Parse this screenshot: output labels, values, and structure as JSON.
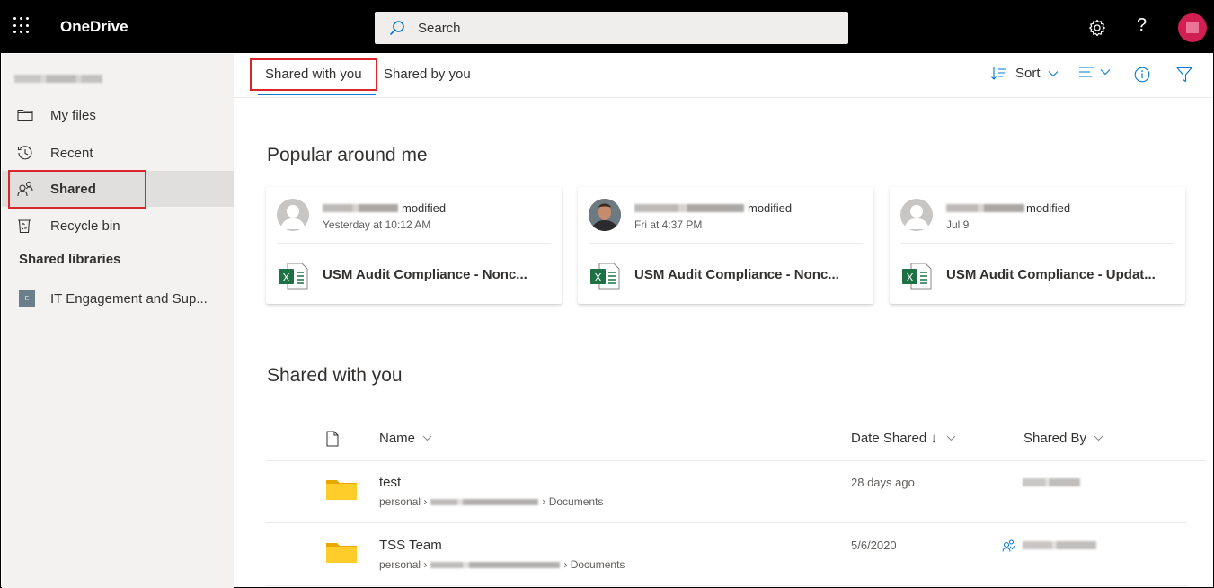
{
  "topbar": {
    "app_name": "OneDrive",
    "search_placeholder": "Search",
    "help_label": "?"
  },
  "sidebar": {
    "items": [
      {
        "label": "My files",
        "icon": "folder-icon"
      },
      {
        "label": "Recent",
        "icon": "clock-icon"
      },
      {
        "label": "Shared",
        "icon": "people-icon",
        "active": true
      },
      {
        "label": "Recycle bin",
        "icon": "recycle-bin-icon"
      }
    ],
    "shared_libraries_heading": "Shared libraries",
    "libraries": [
      {
        "label": "IT Engagement and Sup...",
        "icon_text": "E"
      }
    ]
  },
  "tabs": [
    {
      "label": "Shared with you",
      "selected": true
    },
    {
      "label": "Shared by you",
      "selected": false
    }
  ],
  "commands": {
    "sort_label": "Sort"
  },
  "popular": {
    "title": "Popular around me",
    "cards": [
      {
        "action": "modified",
        "when": "Yesterday at 10:12 AM",
        "file": "USM Audit Compliance - Nonc..."
      },
      {
        "action": "modified",
        "when": "Fri at 4:37 PM",
        "file": "USM Audit Compliance - Nonc..."
      },
      {
        "action": "modified",
        "when": "Jul 9",
        "file": "USM Audit Compliance - Updat..."
      }
    ]
  },
  "shared_with_you": {
    "title": "Shared with you",
    "columns": {
      "name": "Name",
      "date_shared": "Date Shared ↓",
      "shared_by": "Shared By"
    },
    "rows": [
      {
        "name": "test",
        "path_start": "personal ›",
        "path_end": "› Documents",
        "date": "28 days ago"
      },
      {
        "name": "TSS Team",
        "path_start": "personal ›",
        "path_end": "› Documents",
        "date": "5/6/2020"
      }
    ]
  },
  "colors": {
    "accent": "#0078d4",
    "highlight": "#d9262a",
    "topbar": "#000000",
    "excel": "#1e7145"
  }
}
